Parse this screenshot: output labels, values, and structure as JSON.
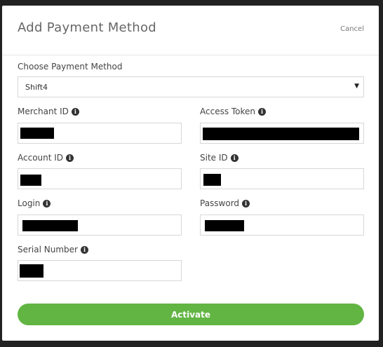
{
  "dialog": {
    "title": "Add Payment Method",
    "cancel_label": "Cancel"
  },
  "payment_method": {
    "label": "Choose Payment Method",
    "selected": "Shift4"
  },
  "fields": {
    "merchant_id": {
      "label": "Merchant ID",
      "value_redacted": true
    },
    "access_token": {
      "label": "Access Token",
      "value_redacted": true
    },
    "account_id": {
      "label": "Account ID",
      "value_redacted": true
    },
    "site_id": {
      "label": "Site ID",
      "value_redacted": true
    },
    "login": {
      "label": "Login",
      "value_redacted": true
    },
    "password": {
      "label": "Password",
      "value_redacted": true
    },
    "serial_number": {
      "label": "Serial Number",
      "value_redacted": true
    }
  },
  "info_icon_glyph": "i",
  "select_arrow_glyph": "▼",
  "activate_label": "Activate",
  "colors": {
    "accent_green": "#62b543",
    "backdrop": "#222222",
    "redaction": "#000000"
  }
}
